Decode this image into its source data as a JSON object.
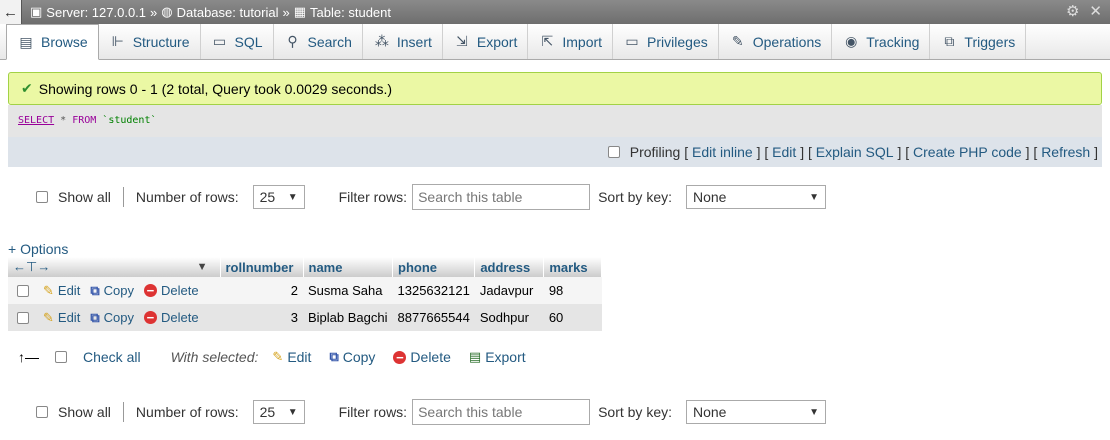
{
  "topbar": {
    "server_label": "Server: 127.0.0.1",
    "database_label": "Database: tutorial",
    "table_label": "Table: student",
    "sep": "»"
  },
  "tabs": [
    {
      "label": "Browse",
      "icon": "browse-icon",
      "active": true
    },
    {
      "label": "Structure",
      "icon": "structure-icon"
    },
    {
      "label": "SQL",
      "icon": "sql-icon"
    },
    {
      "label": "Search",
      "icon": "search-icon"
    },
    {
      "label": "Insert",
      "icon": "insert-icon"
    },
    {
      "label": "Export",
      "icon": "export-icon"
    },
    {
      "label": "Import",
      "icon": "import-icon"
    },
    {
      "label": "Privileges",
      "icon": "privileges-icon"
    },
    {
      "label": "Operations",
      "icon": "operations-icon"
    },
    {
      "label": "Tracking",
      "icon": "tracking-icon"
    },
    {
      "label": "Triggers",
      "icon": "triggers-icon"
    }
  ],
  "message": "Showing rows 0 - 1 (2 total, Query took 0.0029 seconds.)",
  "sql": {
    "kw_select": "SELECT",
    "star": " * ",
    "kw_from": "FROM",
    "table": " `student`"
  },
  "query_tools": {
    "profiling": "Profiling",
    "lbr": "[",
    "rbr": "]",
    "edit_inline": "Edit inline",
    "edit": "Edit",
    "explain_sql": "Explain SQL",
    "create_php": "Create PHP code",
    "refresh": "Refresh"
  },
  "nav": {
    "show_all": "Show all",
    "number_of_rows_label": "Number of rows:",
    "number_of_rows_value": "25",
    "filter_rows_label": "Filter rows:",
    "filter_placeholder": "Search this table",
    "sort_by_key_label": "Sort by key:",
    "sort_by_key_value": "None"
  },
  "options_link": "+ Options",
  "table": {
    "columns": [
      "rollnumber",
      "name",
      "phone",
      "address",
      "marks"
    ],
    "rows": [
      {
        "rollnumber": "2",
        "name": "Susma Saha",
        "phone": "1325632121",
        "address": "Jadavpur",
        "marks": "98"
      },
      {
        "rollnumber": "3",
        "name": "Biplab Bagchi",
        "phone": "8877665544",
        "address": "Sodhpur",
        "marks": "60"
      }
    ],
    "actions": {
      "edit": "Edit",
      "copy": "Copy",
      "delete": "Delete"
    }
  },
  "with_selected": {
    "check_all": "Check all",
    "label": "With selected:",
    "edit": "Edit",
    "copy": "Copy",
    "delete": "Delete",
    "export": "Export"
  },
  "colors": {
    "link": "#235a81",
    "success_bg": "#ebf8a4",
    "success_border": "#a2d246",
    "delete_red": "#dd3333"
  }
}
